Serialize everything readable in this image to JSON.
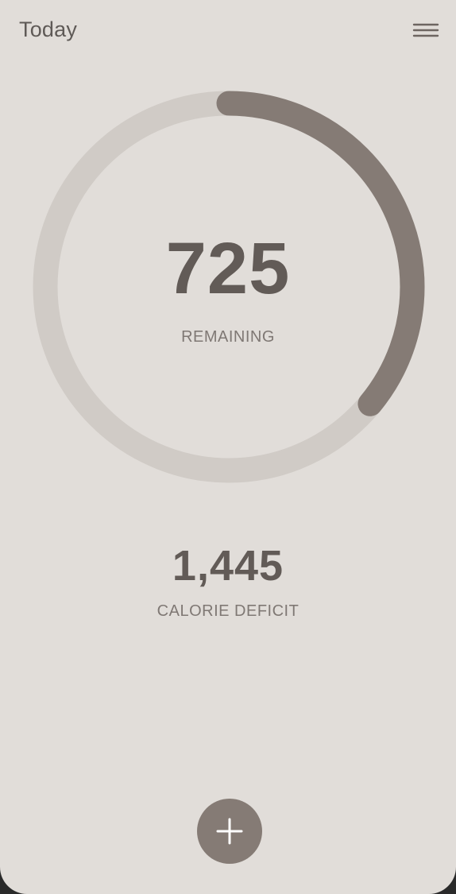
{
  "header": {
    "title": "Today",
    "menu_icon": "hamburger-menu-icon"
  },
  "summary": {
    "remaining_value": "725",
    "remaining_label": "REMAINING",
    "progress_fraction": 0.36,
    "deficit_value": "1,445",
    "deficit_label": "CALORIE DEFICIT"
  },
  "actions": {
    "add_icon": "plus-icon"
  },
  "colors": {
    "background": "#e1ddd9",
    "ring_track": "#d0cbc6",
    "ring_progress": "#857b75",
    "text_primary": "#625b57",
    "text_secondary": "#7f7874"
  }
}
